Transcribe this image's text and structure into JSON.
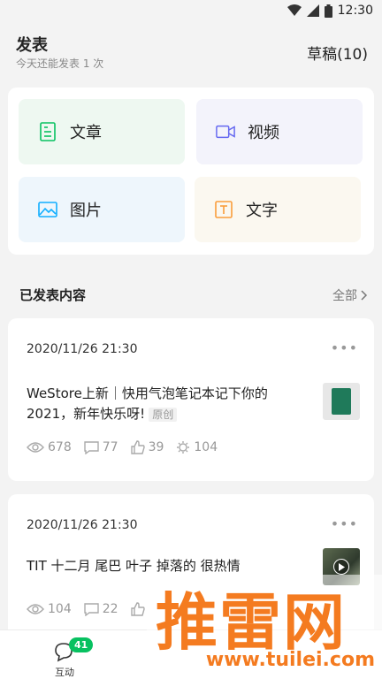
{
  "status_bar": {
    "time": "12:30",
    "icons": [
      "wifi-icon",
      "signal-icon",
      "battery-icon"
    ]
  },
  "header": {
    "title": "发表",
    "subtitle": "今天还能发表 1 次",
    "drafts_label": "草稿(10)"
  },
  "post_types": [
    {
      "label": "文章",
      "icon": "article-icon",
      "color": "#07c160"
    },
    {
      "label": "视频",
      "icon": "video-icon",
      "color": "#6467f0"
    },
    {
      "label": "图片",
      "icon": "image-icon",
      "color": "#10aeff"
    },
    {
      "label": "文字",
      "icon": "text-icon",
      "color": "#fa9d3b"
    }
  ],
  "published": {
    "title": "已发表内容",
    "view_all": "全部",
    "posts": [
      {
        "date": "2020/11/26 21:30",
        "title": "WeStore上新｜快用气泡笔记本记下你的2021，新年快乐呀!",
        "tag": "原创",
        "thumb": "notebook-thumbnail",
        "stats": {
          "views": "678",
          "comments": "77",
          "likes": "39",
          "shares": "104"
        }
      },
      {
        "date": "2020/11/26 21:30",
        "title": "TIT 十二月 尾巴 叶子 掉落的 很热情",
        "thumb": "video-thumbnail",
        "stats": {
          "views": "104",
          "comments": "22"
        }
      }
    ]
  },
  "bottom_nav": {
    "interact_label": "互动",
    "interact_badge": "41"
  },
  "watermark": {
    "logo": "推雷网",
    "url": "www.tuilei.com"
  }
}
